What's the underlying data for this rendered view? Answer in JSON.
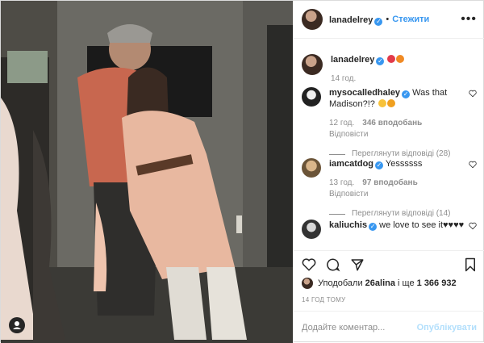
{
  "header": {
    "username": "lanadelrey",
    "separator": "•",
    "follow_label": "Стежити"
  },
  "caption": {
    "username": "lanadelrey",
    "time": "14 год."
  },
  "comments": [
    {
      "username": "mysocalledhaley",
      "text": "Was that Madison?!?",
      "time": "12 год.",
      "likes": "346 вподобань",
      "reply": "Відповісти",
      "view_replies": "Переглянути відповіді (28)"
    },
    {
      "username": "iamcatdog",
      "text": "Yessssss",
      "time": "13 год.",
      "likes": "97 вподобань",
      "reply": "Відповісти",
      "view_replies": "Переглянути відповіді (14)"
    },
    {
      "username": "kaliuchis",
      "text": "we love to see it♥♥♥♥"
    }
  ],
  "likes": {
    "prefix": "Уподобали ",
    "user": "26alina",
    "middle": " і ще ",
    "count": "1 366 932"
  },
  "post_time": "14 ГОД ТОМУ",
  "add_comment": {
    "placeholder": "Додайте коментар...",
    "publish_label": "Опублікувати"
  },
  "colors": {
    "accent": "#3897f0",
    "muted": "#8e8e8e",
    "publish_disabled": "#b2dffc"
  }
}
